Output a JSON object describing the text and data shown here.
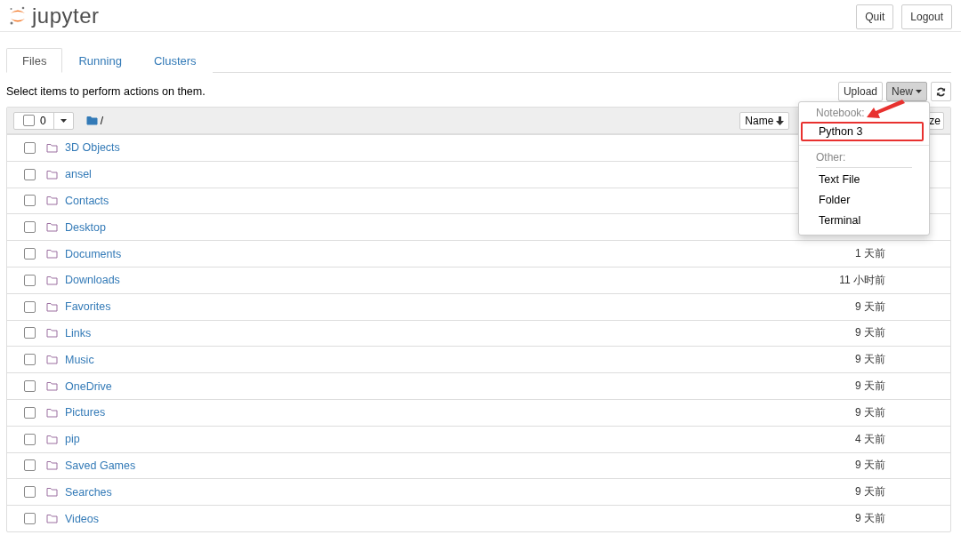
{
  "header": {
    "logo": "jupyter",
    "buttons": [
      "Quit",
      "Logout"
    ]
  },
  "tabs": [
    {
      "label": "Files",
      "selected": true
    },
    {
      "label": "Running",
      "selected": false
    },
    {
      "label": "Clusters",
      "selected": false
    }
  ],
  "toolbar": {
    "hint": "Select items to perform actions on them.",
    "upload": "Upload",
    "new": "New"
  },
  "list_header": {
    "selected_count": "0",
    "all_checked": false,
    "path": "/",
    "sort_button": "Name",
    "column_3": "ze"
  },
  "rows": [
    {
      "name": "3D Objects",
      "checked": false
    },
    {
      "name": "ansel",
      "checked": false
    },
    {
      "name": "Contacts",
      "checked": false
    },
    {
      "name": "Desktop",
      "checked": false
    },
    {
      "name": "Documents",
      "checked": false,
      "modified": "1 天前"
    },
    {
      "name": "Downloads",
      "checked": false,
      "modified": "11 小时前"
    },
    {
      "name": "Favorites",
      "checked": false,
      "modified": "9 天前"
    },
    {
      "name": "Links",
      "checked": false,
      "modified": "9 天前"
    },
    {
      "name": "Music",
      "checked": false,
      "modified": "9 天前"
    },
    {
      "name": "OneDrive",
      "checked": false,
      "modified": "9 天前"
    },
    {
      "name": "Pictures",
      "checked": false,
      "modified": "9 天前"
    },
    {
      "name": "pip",
      "checked": false,
      "modified": "4 天前"
    },
    {
      "name": "Saved Games",
      "checked": false,
      "modified": "9 天前"
    },
    {
      "name": "Searches",
      "checked": false,
      "modified": "9 天前"
    },
    {
      "name": "Videos",
      "checked": false,
      "modified": "9 天前"
    }
  ],
  "new_menu": {
    "sections": [
      {
        "heading": "Notebook:",
        "items": [
          {
            "label": "Python 3",
            "highlighted": true
          }
        ]
      },
      {
        "heading": "Other:",
        "items": [
          {
            "label": "Text File",
            "highlighted": false
          },
          {
            "label": "Folder",
            "highlighted": false
          },
          {
            "label": "Terminal",
            "highlighted": false
          }
        ]
      }
    ]
  }
}
